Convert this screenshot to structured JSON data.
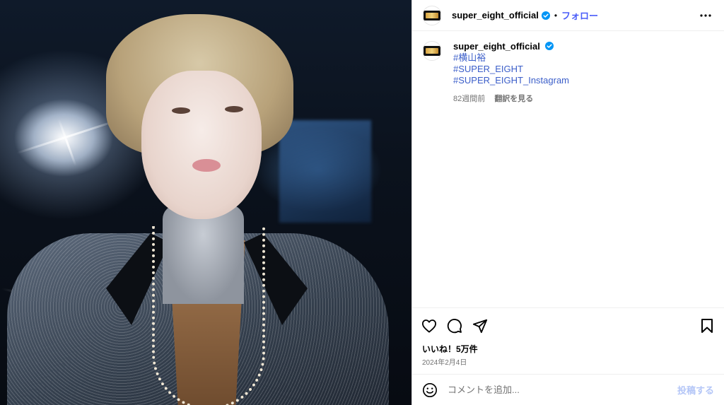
{
  "post": {
    "username": "super_eight_official",
    "follow_label": "フォロー",
    "separator": "•",
    "verified_icon": "verified-badge-icon",
    "more_icon": "more-options-icon"
  },
  "caption": {
    "username": "super_eight_official",
    "tags": [
      "#横山裕",
      "#SUPER_EIGHT",
      "#SUPER_EIGHT_Instagram"
    ],
    "time_ago": "82週間前",
    "translate_label": "翻訳を見る"
  },
  "engagement": {
    "likes": "いいね！5万件",
    "date": "2024年2月4日"
  },
  "comment": {
    "placeholder": "コメントを追加...",
    "post_label": "投稿する"
  },
  "colors": {
    "accent": "#4a5df9",
    "hashtag": "#3b5ec9",
    "muted": "#737373",
    "post_disabled": "#b4c6f7",
    "verified": "#0095f6"
  }
}
